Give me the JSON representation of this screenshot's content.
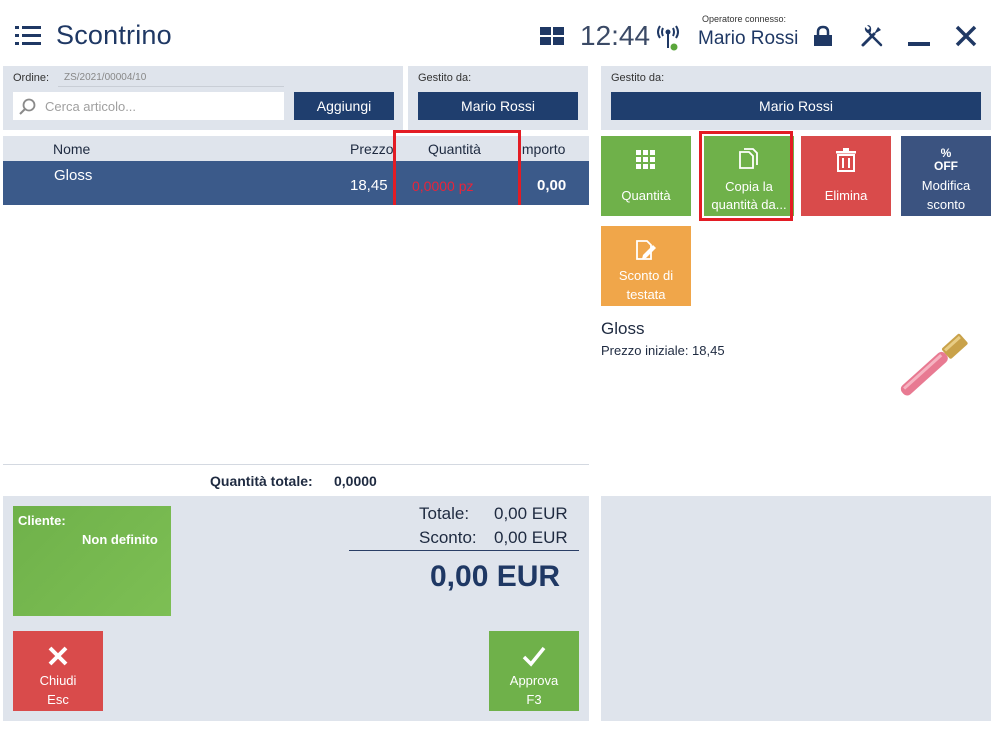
{
  "header": {
    "title": "Scontrino",
    "clock": "12:44",
    "operator_caption": "Operatore connesso:",
    "operator_name": "Mario Rossi"
  },
  "order": {
    "label": "Ordine:",
    "number": "ZS/2021/00004/10",
    "search_placeholder": "Cerca articolo...",
    "add_label": "Aggiungi"
  },
  "managed_left": {
    "label": "Gestito da:",
    "value": "Mario Rossi"
  },
  "managed_right": {
    "label": "Gestito da:",
    "value": "Mario Rossi"
  },
  "table": {
    "columns": [
      "Nome",
      "Prezzo",
      "Quantità",
      "Importo"
    ],
    "rows": [
      {
        "name": "Gloss",
        "price": "18,45",
        "quantity": "0,0000 pz",
        "amount": "0,00"
      }
    ],
    "total_quantity_label": "Quantità totale:",
    "total_quantity_value": "0,0000"
  },
  "customer": {
    "label": "Cliente:",
    "value": "Non definito"
  },
  "totals": {
    "total_label": "Totale:",
    "total_value": "0,00 EUR",
    "discount_label": "Sconto:",
    "discount_value": "0,00 EUR",
    "grand_total": "0,00 EUR"
  },
  "buttons": {
    "close_line1": "Chiudi",
    "close_line2": "Esc",
    "approve_line1": "Approva",
    "approve_line2": "F3"
  },
  "actions": [
    {
      "label_line1": "Quantità",
      "label_line2": "",
      "icon": "keypad-icon"
    },
    {
      "label_line1": "Copia la",
      "label_line2": "quantità da...",
      "icon": "copy-icon"
    },
    {
      "label_line1": "Elimina",
      "label_line2": "",
      "icon": "trash-icon"
    },
    {
      "label_line1": "Modifica",
      "label_line2": "sconto",
      "icon": "percent-off-icon",
      "icon_text_top": "%",
      "icon_text_bottom": "OFF"
    },
    {
      "label_line1": "Sconto di",
      "label_line2": "testata",
      "icon": "edit-document-icon"
    }
  ],
  "product": {
    "name": "Gloss",
    "price_label": "Prezzo iniziale: 18,45"
  },
  "colors": {
    "navy": "#1f3e6e",
    "green": "#6fb14a",
    "red": "#d94b4b",
    "orange": "#f0a64a",
    "slate": "#3b5380",
    "highlight": "#e31c24"
  }
}
